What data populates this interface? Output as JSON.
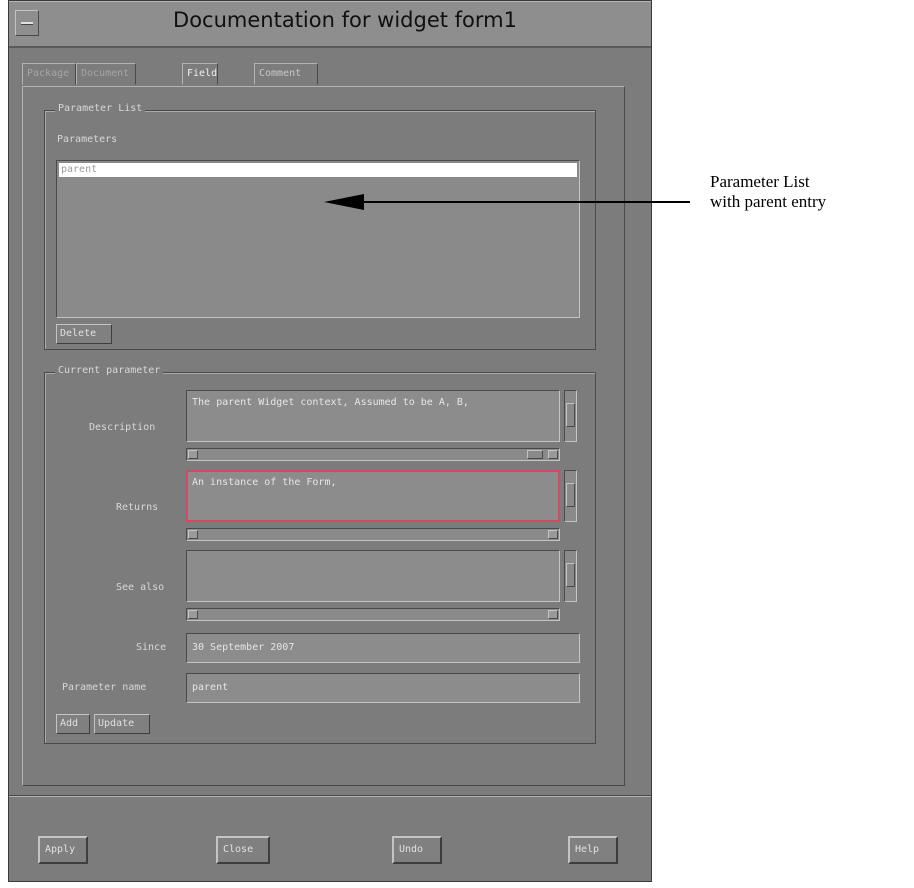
{
  "window": {
    "title": "Documentation for widget form1"
  },
  "tabs": [
    {
      "label": "Package"
    },
    {
      "label": "Document"
    },
    {
      "label": "Field"
    },
    {
      "label": "Comment"
    }
  ],
  "parameter_list": {
    "group_title": "Parameter List",
    "parameters_label": "Parameters",
    "items": [
      "parent"
    ],
    "delete_label": "Delete"
  },
  "current_parameter": {
    "group_title": "Current parameter",
    "description_label": "Description",
    "description_value": "The parent Widget context, Assumed to be A, B,",
    "returns_label": "Returns",
    "returns_value": "An instance of the Form,",
    "see_also_label": "See also",
    "see_also_value": "",
    "since_label": "Since",
    "since_value": "30 September 2007",
    "parameter_name_label": "Parameter name",
    "parameter_name_value": "parent",
    "add_label": "Add",
    "update_label": "Update"
  },
  "footer": {
    "apply_label": "Apply",
    "close_label": "Close",
    "undo_label": "Undo",
    "help_label": "Help"
  },
  "annotation": {
    "line1": "Parameter List",
    "line2": "with parent entry"
  }
}
